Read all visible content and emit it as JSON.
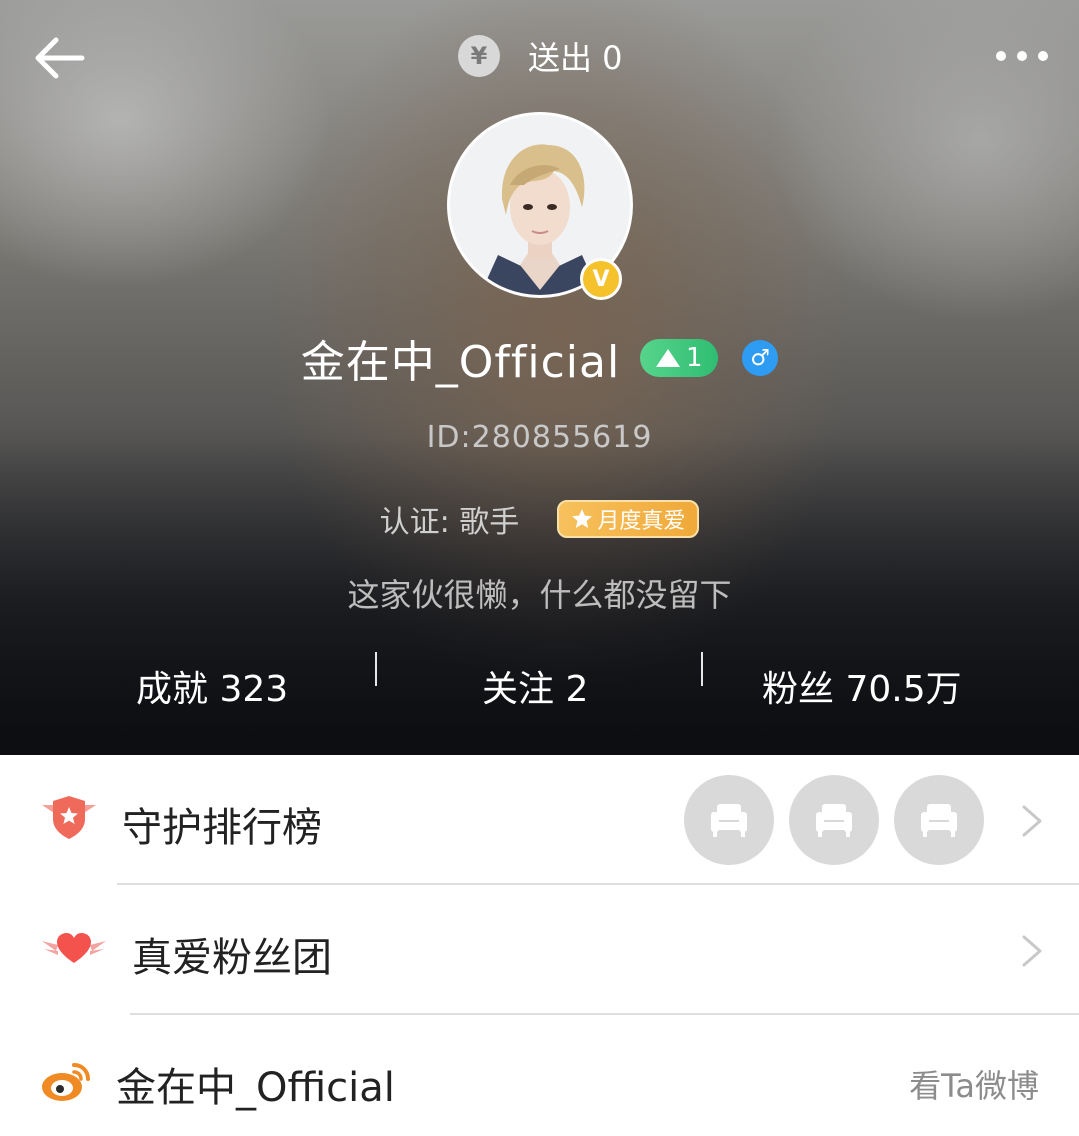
{
  "header": {
    "sent_label": "送出 0",
    "coin_symbol": "¥"
  },
  "profile": {
    "name": "金在中_Official",
    "level": "1",
    "gender_symbol": "♂",
    "uid": "ID:280855619",
    "certification": "认证: 歌手",
    "monthly_badge": "月度真爱",
    "bio": "这家伙很懒，什么都没留下",
    "verified_mark": "V"
  },
  "stats": {
    "achievements": "成就 323",
    "following": "关注 2",
    "followers": "粉丝 70.5万"
  },
  "list": {
    "guard_ranking": "守护排行榜",
    "fan_club": "真爱粉丝团",
    "weibo_name": "金在中_Official",
    "weibo_link": "看Ta微博"
  },
  "colors": {
    "level_badge": "#3fc97d",
    "gender_badge": "#2e9cf2",
    "verified_badge": "#f6c22c",
    "monthly_badge": "#f2b04a",
    "guard_icon": "#ef6a5a",
    "heart_icon": "#f4524d",
    "weibo_icon": "#f08a24"
  }
}
